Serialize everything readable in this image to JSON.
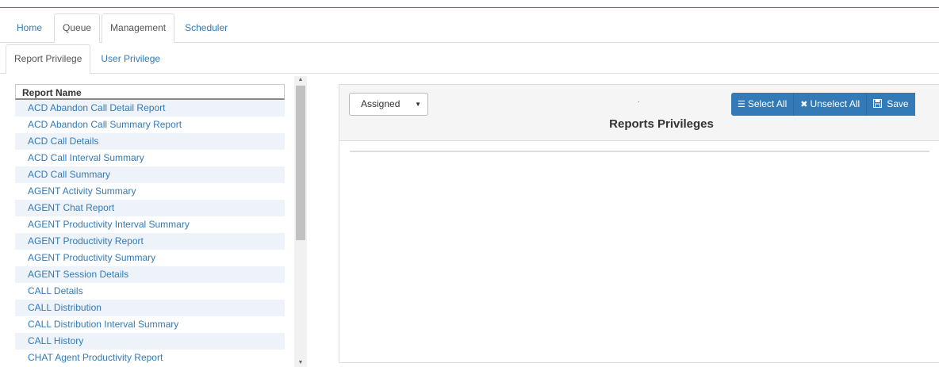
{
  "main_tabs": [
    {
      "label": "Home"
    },
    {
      "label": "Queue"
    },
    {
      "label": "Management"
    },
    {
      "label": "Scheduler"
    }
  ],
  "sub_tabs": [
    {
      "label": "Report Privilege"
    },
    {
      "label": "User Privilege"
    }
  ],
  "report_list": {
    "header": "Report Name",
    "items": [
      "ACD Abandon Call Detail Report",
      "ACD Abandon Call Summary Report",
      "ACD Call Details",
      "ACD Call Interval Summary",
      "ACD Call Summary",
      "AGENT Activity Summary",
      "AGENT Chat Report",
      "AGENT Productivity Interval Summary",
      "AGENT Productivity Report",
      "AGENT Productivity Summary",
      "AGENT Session Details",
      "CALL Details",
      "CALL Distribution",
      "CALL Distribution Interval Summary",
      "CALL History",
      "CHAT Agent Productivity Report"
    ]
  },
  "panel": {
    "filter_value": "Assigned",
    "dot": ".",
    "title": "Reports Privileges",
    "select_all": "Select All",
    "unselect_all": "Unselect All",
    "save": "Save"
  },
  "colors": {
    "accent": "#337ab7",
    "top_rule": "#3c7f97"
  },
  "icons": {
    "select_all": "list-icon",
    "unselect_all": "times-icon",
    "save": "floppy-disk-icon"
  }
}
